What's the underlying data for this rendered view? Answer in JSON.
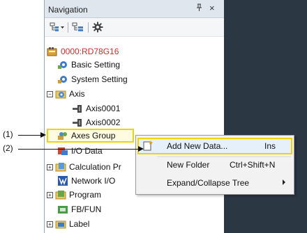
{
  "navigation": {
    "title": "Navigation",
    "pin_glyph": "ᵖ",
    "close_glyph": "×",
    "toolbar": [
      {
        "icon": "tree-view-dropdown-icon"
      },
      {
        "icon": "tree-list-icon"
      },
      {
        "icon": "gear-icon"
      }
    ]
  },
  "tree": {
    "root": "0000:RD78G16",
    "basic_setting": "Basic Setting",
    "system_setting": "System Setting",
    "axis": "Axis",
    "axis1": "Axis0001",
    "axis2": "Axis0002",
    "axes_group": "Axes Group",
    "io_data": "I/O Data",
    "calculation": "Calculation Pr",
    "network_io": "Network I/O",
    "program": "Program",
    "fbfun": "FB/FUN",
    "label": "Label"
  },
  "context_menu": {
    "items": [
      {
        "label": "Add New Data...",
        "shortcut": "Ins"
      },
      {
        "label": "New Folder",
        "shortcut": "Ctrl+Shift+N"
      },
      {
        "label": "Expand/Collapse Tree",
        "shortcut": ""
      }
    ]
  },
  "callouts": {
    "c1": "(1)",
    "c2": "(2)"
  },
  "colors": {
    "highlight": "#f0d400",
    "root_text": "#d22b2b",
    "dark_area": "#2c3744"
  }
}
